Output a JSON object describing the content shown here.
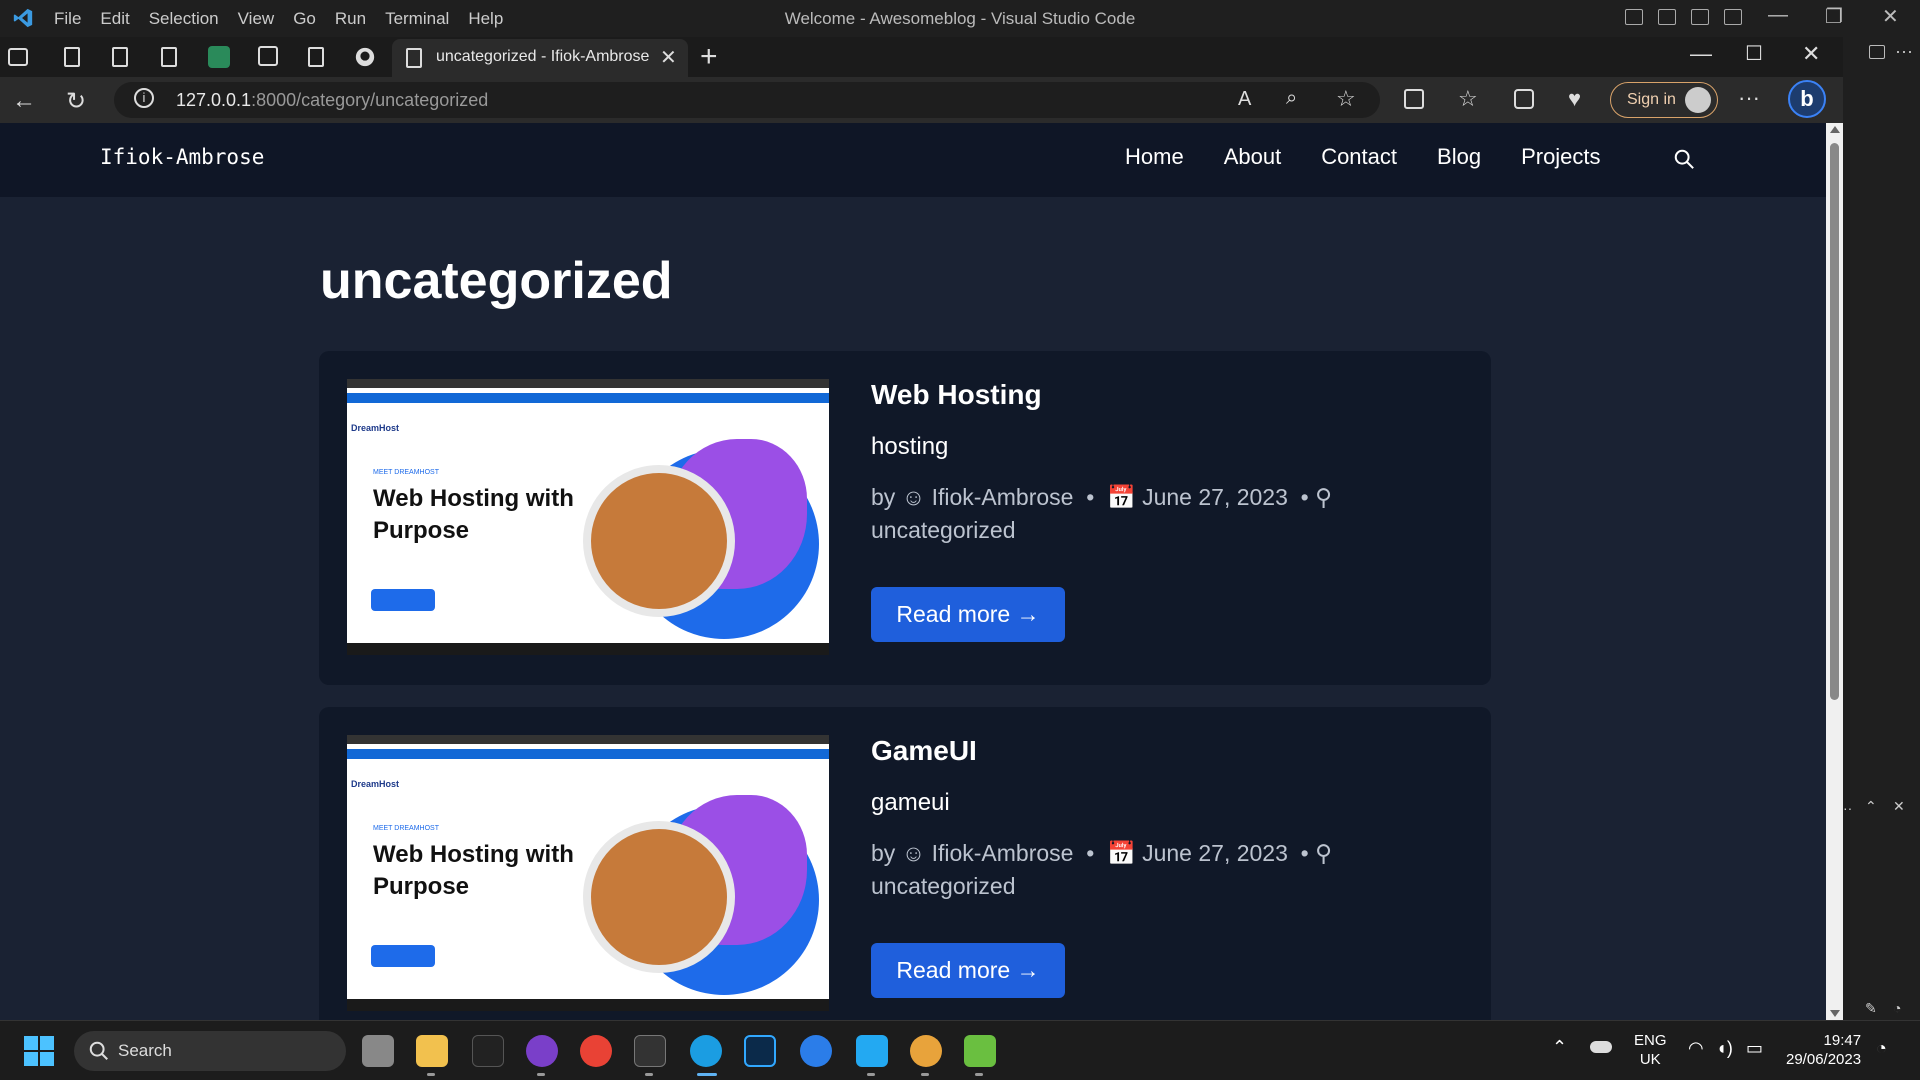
{
  "vscode": {
    "menu": [
      "File",
      "Edit",
      "Selection",
      "View",
      "Go",
      "Run",
      "Terminal",
      "Help"
    ],
    "window_title": "Welcome - Awesomeblog - Visual Studio Code"
  },
  "browser": {
    "active_tab_title": "uncategorized - Ifiok-Ambrose",
    "url_host": "127.0.0.1",
    "url_rest": ":8000/category/uncategorized",
    "signin_label": "Sign in"
  },
  "site": {
    "brand": "Ifiok-Ambrose",
    "nav": [
      "Home",
      "About",
      "Contact",
      "Blog",
      "Projects"
    ],
    "page_heading": "uncategorized",
    "posts": [
      {
        "title": "Web Hosting",
        "excerpt": "hosting",
        "author": "Ifiok-Ambrose",
        "date": "June 27, 2023",
        "category": "uncategorized",
        "read_more": "Read more →",
        "thumb_heading": "Web Hosting with Purpose",
        "thumb_brand": "DreamHost",
        "thumb_tag": "MEET DREAMHOST"
      },
      {
        "title": "GameUI",
        "excerpt": "gameui",
        "author": "Ifiok-Ambrose",
        "date": "June 27, 2023",
        "category": "uncategorized",
        "read_more": "Read more →",
        "thumb_heading": "Web Hosting with Purpose",
        "thumb_brand": "DreamHost",
        "thumb_tag": "MEET DREAMHOST"
      }
    ],
    "by_label": "by"
  },
  "taskbar": {
    "search_label": "Search",
    "lang": "ENG",
    "region": "UK",
    "time": "19:47",
    "date": "29/06/2023"
  },
  "colors": {
    "accent": "#1f5fdc",
    "page_bg": "#1a2233",
    "card_bg": "#101828"
  }
}
